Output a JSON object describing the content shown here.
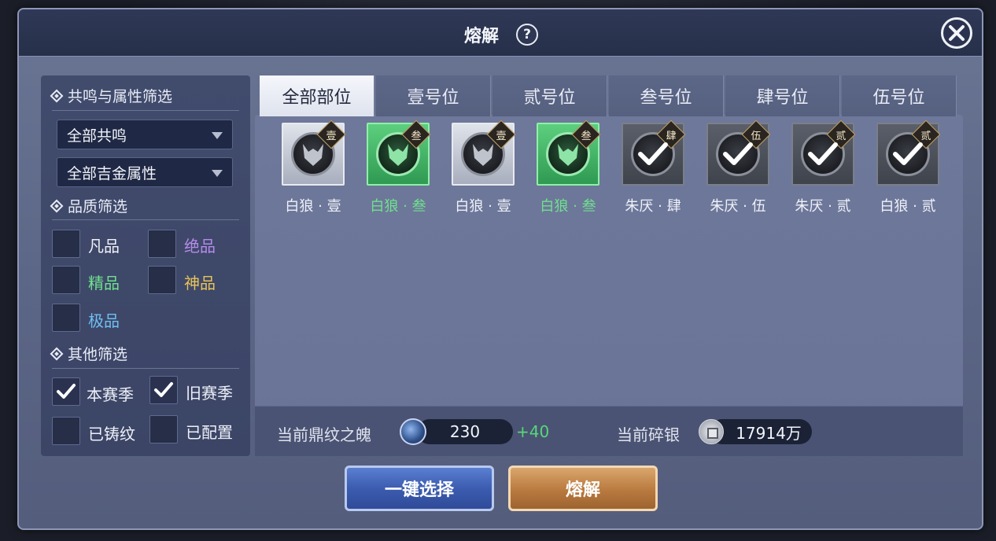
{
  "dialog": {
    "title": "熔解",
    "help_icon": "?"
  },
  "filters": {
    "resonance_header": "共鸣与属性筛选",
    "resonance_dropdown": "全部共鸣",
    "attribute_dropdown": "全部吉金属性",
    "quality_header": "品质筛选",
    "qualities": [
      {
        "label": "凡品",
        "color": "#f0f2f8",
        "checked": false
      },
      {
        "label": "绝品",
        "color": "#b58bea",
        "checked": false
      },
      {
        "label": "精品",
        "color": "#6fe08e",
        "checked": false
      },
      {
        "label": "神品",
        "color": "#e8c35a",
        "checked": false
      },
      {
        "label": "极品",
        "color": "#6fbff0",
        "checked": false
      }
    ],
    "other_header": "其他筛选",
    "others": [
      {
        "label": "本赛季",
        "checked": true
      },
      {
        "label": "旧赛季",
        "checked": true
      },
      {
        "label": "已铸纹",
        "checked": false
      },
      {
        "label": "已配置",
        "checked": false
      }
    ]
  },
  "tabs": [
    "全部部位",
    "壹号位",
    "贰号位",
    "叁号位",
    "肆号位",
    "伍号位"
  ],
  "active_tab": "全部部位",
  "items": [
    {
      "name": "白狼 · 壹",
      "slot": "壹",
      "quality": "white",
      "selected": false
    },
    {
      "name": "白狼 · 叁",
      "slot": "叁",
      "quality": "green",
      "selected": false
    },
    {
      "name": "白狼 · 壹",
      "slot": "壹",
      "quality": "white",
      "selected": false
    },
    {
      "name": "白狼 · 叁",
      "slot": "叁",
      "quality": "green",
      "selected": false
    },
    {
      "name": "朱厌 · 肆",
      "slot": "肆",
      "quality": "dark",
      "selected": true
    },
    {
      "name": "朱厌 · 伍",
      "slot": "伍",
      "quality": "dark",
      "selected": true
    },
    {
      "name": "朱厌 · 贰",
      "slot": "贰",
      "quality": "dark",
      "selected": true
    },
    {
      "name": "白狼 · 贰",
      "slot": "贰",
      "quality": "dark",
      "selected": true
    }
  ],
  "info": {
    "soul_label": "当前鼎纹之魄",
    "soul_value": "230",
    "soul_gain": "+40",
    "silver_label": "当前碎银",
    "silver_value": "17914万"
  },
  "buttons": {
    "select_all": "一键选择",
    "melt": "熔解"
  }
}
